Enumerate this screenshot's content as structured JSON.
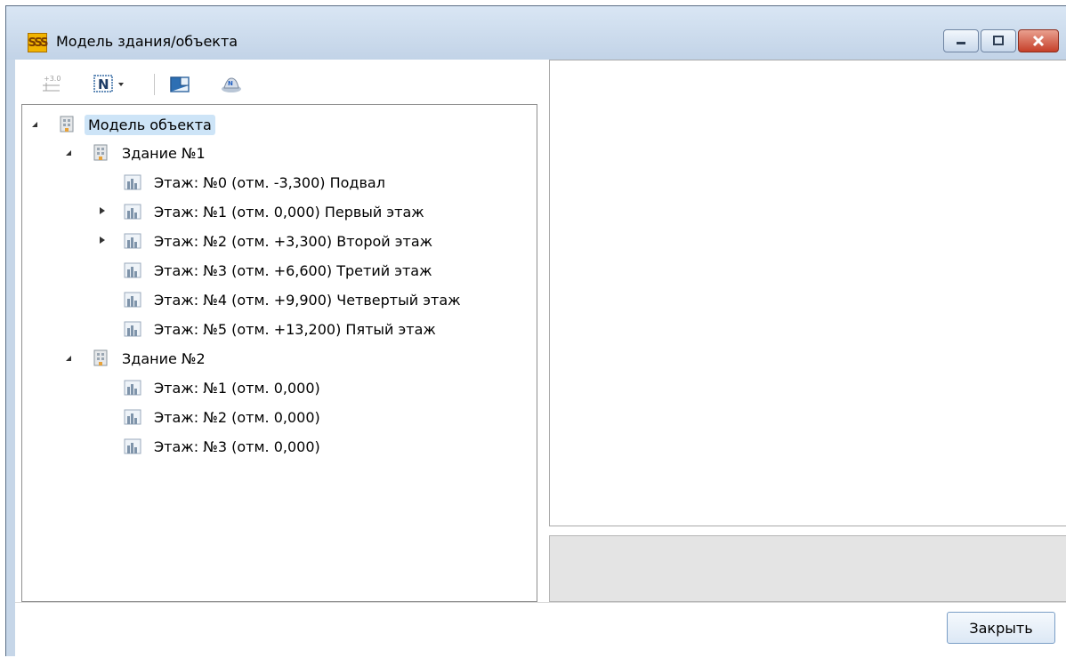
{
  "window": {
    "title": "Модель здания/объекта",
    "buttons": [
      "minimize-icon",
      "maximize-icon",
      "close-icon"
    ]
  },
  "toolbar": {
    "items": [
      {
        "name": "elevation-button",
        "icon": "elevation-icon",
        "label": "+3.0"
      },
      {
        "name": "numbering-button",
        "icon": "numbering-icon",
        "label": "N"
      },
      {
        "name": "floor-plan-button",
        "icon": "floor-plan-icon"
      },
      {
        "name": "building-model-button",
        "icon": "building-3d-icon"
      }
    ]
  },
  "tree": {
    "root": {
      "label": "Модель объекта",
      "expanded": true,
      "selected": true,
      "children": [
        {
          "label": "Здание №1",
          "expanded": true,
          "children": [
            {
              "label": "Этаж: №0 (отм. -3,300) Подвал",
              "has_children": false
            },
            {
              "label": "Этаж: №1 (отм. 0,000) Первый этаж",
              "has_children": true
            },
            {
              "label": "Этаж: №2 (отм. +3,300) Второй этаж",
              "has_children": true
            },
            {
              "label": "Этаж: №3 (отм. +6,600) Третий этаж",
              "has_children": false
            },
            {
              "label": "Этаж: №4 (отм. +9,900) Четвертый этаж",
              "has_children": false
            },
            {
              "label": "Этаж: №5 (отм. +13,200) Пятый этаж",
              "has_children": false
            }
          ]
        },
        {
          "label": "Здание №2",
          "expanded": true,
          "children": [
            {
              "label": "Этаж: №1 (отм. 0,000)",
              "has_children": false
            },
            {
              "label": "Этаж: №2 (отм. 0,000)",
              "has_children": false
            },
            {
              "label": "Этаж: №3 (отм. 0,000)",
              "has_children": false
            }
          ]
        }
      ]
    }
  },
  "footer": {
    "close_label": "Закрыть"
  },
  "colors": {
    "selection": "#cde4f7",
    "title_gradient_top": "#d9e6f4",
    "close_red": "#c6402a"
  }
}
